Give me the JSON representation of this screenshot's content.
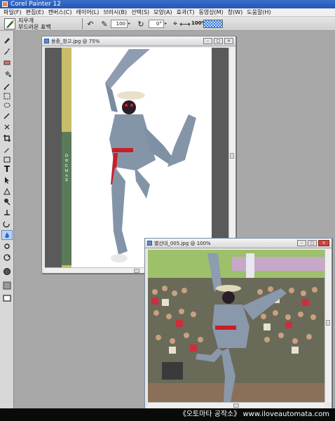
{
  "app": {
    "title": "Corel Painter 12"
  },
  "menu": [
    "파일(F)",
    "편집(E)",
    "캔버스(C)",
    "레이어(L)",
    "브러시(B)",
    "선택(S)",
    "모양(A)",
    "효과(T)",
    "동영상(M)",
    "창(W)",
    "도움말(H)"
  ],
  "property_bar": {
    "brush_category": "지우개",
    "brush_variant": "부드러운 표백",
    "size_value": "100",
    "angle_value": "0°",
    "zoom_text": "100%"
  },
  "documents": [
    {
      "title": "용중_창고.jpg @ 75%"
    },
    {
      "title": "별산대_005.jpg @ 100%"
    }
  ],
  "caption": "《오토마타 공작소》 www.iloveautomata.com",
  "icons": {
    "tools": [
      "brush-icon",
      "dropper-icon",
      "eraser-icon",
      "paint-bucket-icon",
      "pen-icon",
      "rect-select-icon",
      "lasso-icon",
      "magic-wand-icon",
      "transform-icon",
      "crop-icon",
      "divine-pen-icon",
      "shape-rect-icon",
      "text-icon",
      "arrow-icon",
      "shape-select-icon",
      "clone-icon",
      "rubber-stamp-icon",
      "dodge-icon",
      "burn-icon",
      "grabber-icon",
      "rotate-icon",
      "mirror-icon",
      "color-swatch-icon",
      "paper-icon",
      "pattern-icon"
    ]
  },
  "colors": {
    "title_bar": "#2457b3",
    "workspace": "#a8a8a8",
    "close_button": "#c8463c"
  }
}
